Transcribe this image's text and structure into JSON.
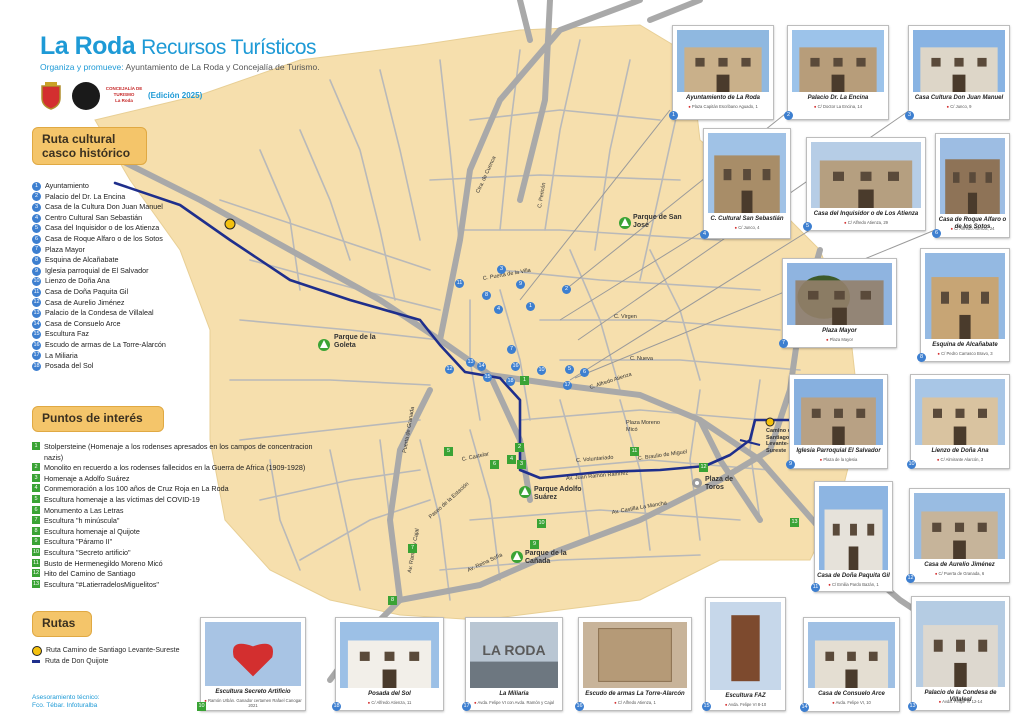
{
  "header": {
    "title": "La Roda",
    "subtitle": "Recursos Turísticos",
    "org_prefix": "Organiza y promueve:",
    "org_text": "Ayuntamiento de La Roda y Concejalía de Turismo.",
    "edition": "(Edición 2025)",
    "logo_text_1": "CONCEJALÍA DE",
    "logo_text_2": "TURISMO",
    "logo_text_3": "La Roda"
  },
  "ruta_cultural": {
    "heading_1": "Ruta cultural",
    "heading_2": "casco histórico",
    "items": [
      {
        "n": "1",
        "label": "Ayuntamiento"
      },
      {
        "n": "2",
        "label": "Palacio del Dr. La Encina"
      },
      {
        "n": "3",
        "label": "Casa de la Cultura Don Juan Manuel"
      },
      {
        "n": "4",
        "label": "Centro Cultural San Sebastián"
      },
      {
        "n": "5",
        "label": "Casa del Inquisidor o de los Atienza"
      },
      {
        "n": "6",
        "label": "Casa de Roque Alfaro o de los Sotos"
      },
      {
        "n": "7",
        "label": "Plaza Mayor"
      },
      {
        "n": "8",
        "label": "Esquina de Alcañabate"
      },
      {
        "n": "9",
        "label": "Iglesia parroquial de El Salvador"
      },
      {
        "n": "10",
        "label": "Lienzo de Doña Ana"
      },
      {
        "n": "11",
        "label": "Casa de Doña Paquita Gil"
      },
      {
        "n": "12",
        "label": "Casa de Aurelio Jiménez"
      },
      {
        "n": "13",
        "label": "Palacio de la Condesa de Villaleal"
      },
      {
        "n": "14",
        "label": "Casa de Consuelo Arce"
      },
      {
        "n": "15",
        "label": "Escultura Faz"
      },
      {
        "n": "16",
        "label": "Escudo de armas de La Torre-Alarcón"
      },
      {
        "n": "17",
        "label": "La Miliaria"
      },
      {
        "n": "18",
        "label": "Posada del Sol"
      }
    ]
  },
  "puntos_interes": {
    "heading": "Puntos de interés",
    "items": [
      {
        "n": "1",
        "label": "Stolpersteine (Homenaje a los rodenses apresados en los campos de concentracion nazis)"
      },
      {
        "n": "2",
        "label": "Monolito en recuerdo a los rodenses fallecidos en la Guerra de Africa (1909-1928)"
      },
      {
        "n": "3",
        "label": "Homenaje a Adolfo Suárez"
      },
      {
        "n": "4",
        "label": "Conmemoración a los 100 años de Cruz Roja en La Roda"
      },
      {
        "n": "5",
        "label": "Escultura homenaje a las víctimas del COVID-19"
      },
      {
        "n": "6",
        "label": "Monumento a Las Letras"
      },
      {
        "n": "7",
        "label": "Escultura \"h minúscula\""
      },
      {
        "n": "8",
        "label": "Escultura  homenaje al Quijote"
      },
      {
        "n": "9",
        "label": "Escultura \"Páramo II\""
      },
      {
        "n": "10",
        "label": "Escultura \"Secreto artificio\""
      },
      {
        "n": "11",
        "label": "Busto de Hermenegildo Moreno Micó"
      },
      {
        "n": "12",
        "label": "Hito del Camino de Santiago"
      },
      {
        "n": "13",
        "label": "Escultura \"#LatierradelosMiguelitos\""
      }
    ]
  },
  "rutas": {
    "heading": "Rutas",
    "items": [
      {
        "label": "Ruta Camino de Santiago Levante-Sureste"
      },
      {
        "label": "Ruta de Don Quijote"
      }
    ]
  },
  "credit": {
    "line_1": "Asesoramiento técnico:",
    "line_2": "Fco. Tébar. Infoturalba"
  },
  "map_labels": {
    "parque_san_jose": "Parque de San José",
    "parque_goleta": "Parque de la Goleta",
    "parque_adolfo": "Parque Adolfo Suárez",
    "parque_canada": "Parque de la Cañada",
    "plaza_toros": "Plaza de Toros",
    "plaza_moreno": "Plaza Moreno Micó",
    "camino_santiago": "Camino de Santiago Levante-Sureste",
    "streets": {
      "cuenca": "Ctra. de Cuenca",
      "pericon": "C. Pericón",
      "alfredo": "C. Alfredo Atienza",
      "nueva": "C. Nueva",
      "virgen": "C. Virgen",
      "castelar": "C. Castelar",
      "voluntariado": "C. Voluntariado",
      "braulio": "C. Braulio de Miguel",
      "ramirez": "Av. Juan Ramón Ramírez",
      "mancha": "Av. Castilla La Mancha",
      "estacion": "Paseo de la Estación",
      "granada": "Puerta de Granada",
      "ramon_cajal": "Av. Ramón y Cajal",
      "reina_sofia": "Av. Reina Sofía",
      "villa": "C. Puerta de la Villa"
    }
  },
  "cards": [
    {
      "n": "1",
      "name": "Ayuntamiento de La Roda",
      "addr": "Plaza Capitán Escribano Aguado, 1"
    },
    {
      "n": "2",
      "name": "Palacio Dr. La Encina",
      "addr": "C/ Doctor La Encina, 14"
    },
    {
      "n": "3",
      "name": "Casa Cultura Don Juan Manuel",
      "addr": "C/ Junco, 9"
    },
    {
      "n": "4",
      "name": "C. Cultural San Sebastián",
      "addr": "C/ Junco, 4"
    },
    {
      "n": "5",
      "name": "Casa del Inquisidor o de Los Atienza",
      "addr": "C/ Alfredo Atienza, 29"
    },
    {
      "n": "6",
      "name": "Casa de Roque Alfaro o de los Sotos",
      "addr": "C/ Alfredo Atienza, 24"
    },
    {
      "n": "7",
      "name": "Plaza Mayor",
      "addr": "Plaza Mayor"
    },
    {
      "n": "8",
      "name": "Esquina de Alcañabate",
      "addr": "C/ Pedro Carrasco Bravo, 3"
    },
    {
      "n": "9",
      "name": "Iglesia Parroquial El Salvador",
      "addr": "Plaza de la Iglesia"
    },
    {
      "n": "10",
      "name": "Lienzo de Doña Ana",
      "addr": "C/ Almirante Alarcón, 3"
    },
    {
      "n": "11",
      "name": "Casa de Doña Paquita Gil",
      "addr": "C/ Emilia Pardo Bazán, 1"
    },
    {
      "n": "12",
      "name": "Casa de Aurelio Jiménez",
      "addr": "C/ Puerta de Granada, 6"
    },
    {
      "n": "13",
      "name": "Palacio de la Condesa de Villaleal",
      "addr": "Avda. Felipe VI 12-14"
    },
    {
      "n": "14",
      "name": "Casa de Consuelo Arce",
      "addr": "Avda. Felipe VI, 10"
    },
    {
      "n": "15",
      "name": "Escultura FAZ",
      "addr": "Avda. Felipe VI 8-10"
    },
    {
      "n": "16",
      "name": "Escudo de armas La Torre-Alarcón",
      "addr": "C/ Alfredo Atienza, 1"
    },
    {
      "n": "17",
      "name": "La Miliaria",
      "addr": "Avda. Felipe VI con Avda. Ramón y Cajal"
    },
    {
      "n": "18",
      "name": "Posada del Sol",
      "addr": "C/ Alfredo Atienza, 11"
    },
    {
      "n": "10",
      "name": "Escultura Secreto Artificio",
      "addr": "Ramón Urbán. Ganador certamen Rafael Canogar 2021"
    }
  ],
  "photo_text": {
    "miliaria": "LA RODA"
  },
  "colors": {
    "land": "#f6dfad",
    "road_main": "#a9a9a9",
    "street": "#b6b6b6",
    "route": "#1f2f8c",
    "accent": "#1e9ad6",
    "tag": "#f4c56a",
    "badge_blue": "#3d7fd0",
    "badge_green": "#3aa335"
  }
}
